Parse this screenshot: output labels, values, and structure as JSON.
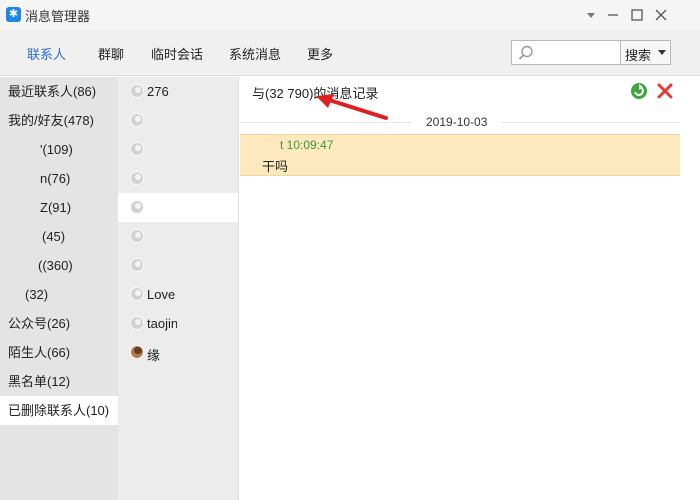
{
  "window": {
    "title": "消息管理器",
    "app_icon": "qq-star-icon",
    "controls": [
      "dropdown-icon",
      "minimize-icon",
      "maximize-icon",
      "close-icon"
    ]
  },
  "nav": {
    "tabs": [
      {
        "label": "联系人",
        "active": true
      },
      {
        "label": "群聊",
        "active": false
      },
      {
        "label": "临时会话",
        "active": false
      },
      {
        "label": "系统消息",
        "active": false
      },
      {
        "label": "更多",
        "active": false
      }
    ],
    "search_placeholder": "",
    "search_button": "搜索"
  },
  "categories": [
    {
      "label": "最近联系人(86)"
    },
    {
      "label": "我的/好友(478)"
    },
    {
      "label": "'(109)"
    },
    {
      "label": "n(76)"
    },
    {
      "label": "Z(91)"
    },
    {
      "label": "(45)"
    },
    {
      "label": "((360)"
    },
    {
      "label": "(32)"
    },
    {
      "label": "公众号(26)"
    },
    {
      "label": "陌生人(66)"
    },
    {
      "label": "黑名单(12)"
    },
    {
      "label": "已删除联系人(10)"
    }
  ],
  "contacts": [
    {
      "name": "276"
    },
    {
      "name": ""
    },
    {
      "name": ""
    },
    {
      "name": ""
    },
    {
      "name": ""
    },
    {
      "name": ""
    },
    {
      "name": ""
    },
    {
      "name": "Love"
    },
    {
      "name": "taojin"
    },
    {
      "name": "缘"
    }
  ],
  "messages": {
    "header": "与(32          790)的消息记录",
    "date": "2019-10-03",
    "items": [
      {
        "sender_time": "t 10:09:47",
        "text": "干吗"
      }
    ],
    "highlight_color": "#fde9bd",
    "sender_color": "#3a9a3a"
  },
  "colors": {
    "accent": "#2b6ecb",
    "arrow": "#e02020"
  }
}
